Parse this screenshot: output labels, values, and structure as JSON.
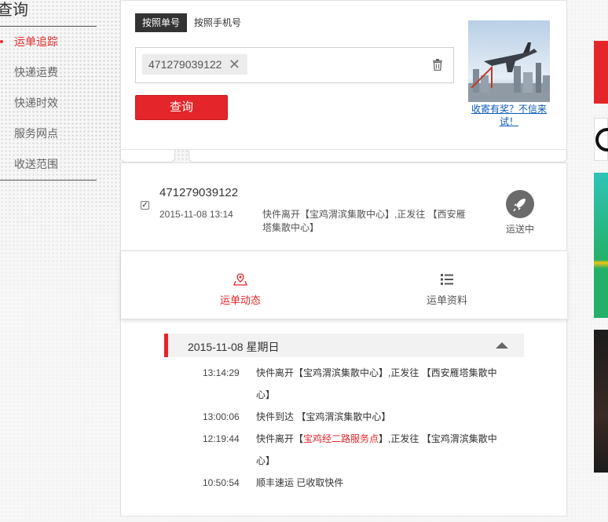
{
  "sidebar": {
    "title": "查询",
    "items": [
      {
        "label": "运单追踪",
        "active": true
      },
      {
        "label": "快递运费"
      },
      {
        "label": "快递时效"
      },
      {
        "label": "服务网点"
      },
      {
        "label": "收送范围"
      }
    ]
  },
  "search": {
    "tabs": [
      "按照单号",
      "按照手机号"
    ],
    "active_tab": "按照单号",
    "chip_value": "471279039122",
    "query_button": "查询",
    "ad_link": "收寄有奖？不信来试！"
  },
  "result": {
    "tracking_no": "471279039122",
    "checked": true,
    "latest_time": "2015-11-08 13:14",
    "latest_desc": "快件离开【宝鸡渭滨集散中心】,正发往 【西安雁塔集散中心】",
    "status": "运送中"
  },
  "detail_tabs": [
    {
      "label": "运单动态",
      "active": true,
      "icon": "map-pin-icon"
    },
    {
      "label": "运单资料",
      "active": false,
      "icon": "list-icon"
    }
  ],
  "timeline": {
    "day": "2015-11-08 星期日",
    "events": [
      {
        "time": "13:14:29",
        "pre": "快件离开【宝鸡渭滨集散中心】,正发往 【西安雁塔集散中",
        "highlight": "",
        "post": "心】"
      },
      {
        "time": "13:00:06",
        "pre": "快件到达 【宝鸡渭滨集散中心】",
        "highlight": "",
        "post": ""
      },
      {
        "time": "12:19:44",
        "pre": "快件离开【",
        "highlight": "宝鸡经二路服务点",
        "post": "】,正发往 【宝鸡渭滨集散中心】"
      },
      {
        "time": "10:50:54",
        "pre": "顺丰速运 已收取快件",
        "highlight": "",
        "post": ""
      }
    ]
  },
  "colors": {
    "accent": "#e4262a",
    "active_tab_bg": "#333333",
    "link": "#0b5ab8"
  }
}
